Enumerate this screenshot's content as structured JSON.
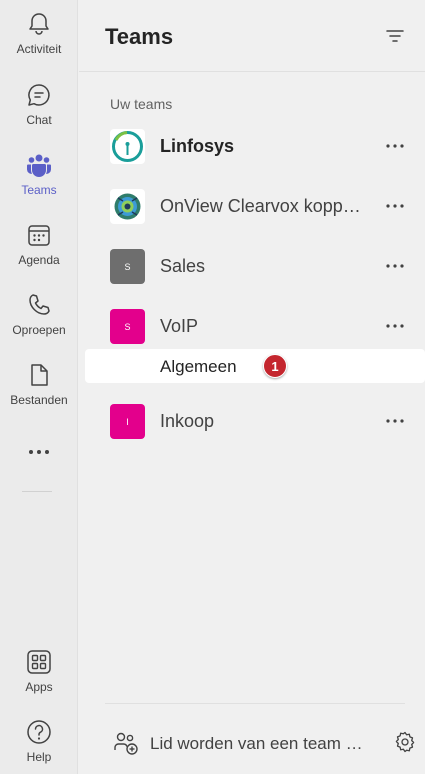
{
  "rail": {
    "items": [
      {
        "label": "Activiteit",
        "icon": "bell-icon"
      },
      {
        "label": "Chat",
        "icon": "chat-icon"
      },
      {
        "label": "Teams",
        "icon": "teams-icon"
      },
      {
        "label": "Agenda",
        "icon": "calendar-icon"
      },
      {
        "label": "Oproepen",
        "icon": "phone-icon"
      },
      {
        "label": "Bestanden",
        "icon": "file-icon"
      },
      {
        "label": "Apps",
        "icon": "apps-icon"
      },
      {
        "label": "Help",
        "icon": "help-icon"
      }
    ],
    "active": "Teams",
    "more_icon": "ellipsis-icon"
  },
  "panel": {
    "title": "Teams",
    "section_label": "Uw teams",
    "teams": [
      {
        "name": "Linfosys",
        "avatar_letter": "",
        "avatar_color": "#ffffff",
        "bold": true
      },
      {
        "name": "OnView Clearvox koppeling",
        "avatar_letter": "",
        "avatar_color": "#ffffff",
        "bold": false
      },
      {
        "name": "Sales",
        "avatar_letter": "S",
        "avatar_color": "#6e6e6e",
        "bold": false
      },
      {
        "name": "VoIP",
        "avatar_letter": "S",
        "avatar_color": "#e3008c",
        "bold": false
      },
      {
        "name": "Inkoop",
        "avatar_letter": "I",
        "avatar_color": "#e3008c",
        "bold": false
      }
    ],
    "channel": {
      "name": "Algemeen",
      "badge": "1"
    },
    "join_label": "Lid worden van een team of er een maken"
  },
  "colors": {
    "accent": "#5b5fc7",
    "badge": "#c4262e",
    "magenta": "#e3008c"
  }
}
